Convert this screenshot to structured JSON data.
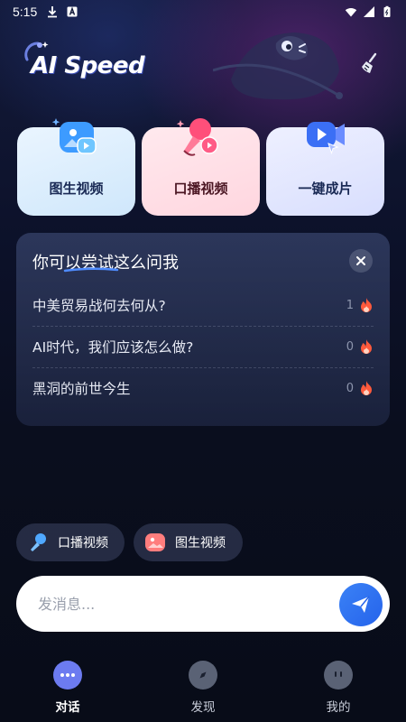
{
  "status_bar": {
    "time": "5:15",
    "left_icons": [
      "download-icon",
      "a-box-icon"
    ],
    "right_icons": [
      "wifi-icon",
      "signal-icon",
      "battery-icon"
    ]
  },
  "header": {
    "logo_text": "AI Speed",
    "clean_icon": "broom-icon"
  },
  "feature_cards": [
    {
      "label": "图生视频",
      "icon": "image-video-icon"
    },
    {
      "label": "口播视频",
      "icon": "microphone-video-icon"
    },
    {
      "label": "一键成片",
      "icon": "video-camera-icon"
    }
  ],
  "suggestions": {
    "title": "你可以尝试这么问我",
    "items": [
      {
        "text": "中美贸易战何去何从?",
        "count": "1"
      },
      {
        "text": "AI时代，我们应该怎么做?",
        "count": "0"
      },
      {
        "text": "黑洞的前世今生",
        "count": "0"
      }
    ]
  },
  "quick_chips": [
    {
      "label": "口播视频",
      "icon": "microphone-icon"
    },
    {
      "label": "图生视频",
      "icon": "image-icon"
    }
  ],
  "message_bar": {
    "placeholder": "发消息...",
    "send_icon": "paper-plane-icon"
  },
  "bottom_nav": [
    {
      "label": "对话",
      "icon": "chat-bubble-icon",
      "active": true
    },
    {
      "label": "发现",
      "icon": "compass-icon",
      "active": false
    },
    {
      "label": "我的",
      "icon": "profile-face-icon",
      "active": false
    }
  ],
  "colors": {
    "background": "#0a0f1f",
    "accent_blue": "#2563eb",
    "fire": "#ff5a3c"
  }
}
